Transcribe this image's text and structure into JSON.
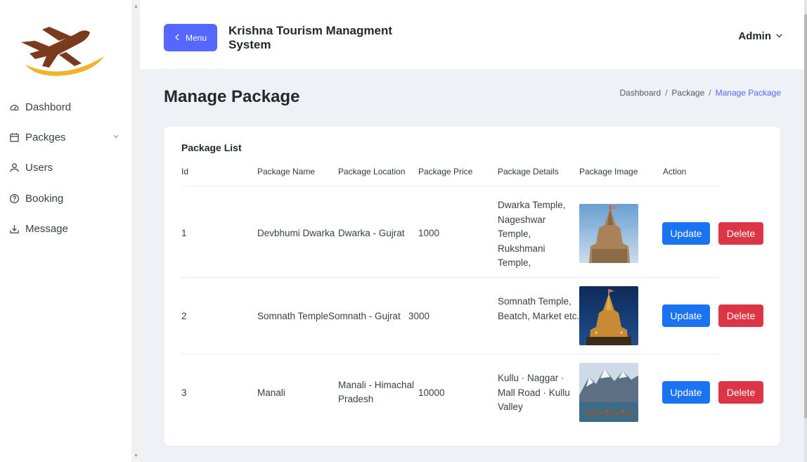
{
  "sidebar": {
    "items": [
      {
        "label": "Dashbord",
        "icon": "dashboard-icon"
      },
      {
        "label": "Packges",
        "icon": "calendar-icon"
      },
      {
        "label": "Users",
        "icon": "user-icon"
      },
      {
        "label": "Booking",
        "icon": "help-circle-icon"
      },
      {
        "label": "Message",
        "icon": "download-icon"
      }
    ]
  },
  "topbar": {
    "menu_label": "Menu",
    "app_title": "Krishna Tourism Managment System",
    "user": "Admin"
  },
  "page": {
    "title": "Manage Package",
    "breadcrumb": [
      "Dashboard",
      "Package",
      "Manage Package"
    ]
  },
  "table": {
    "title": "Package List",
    "headers": [
      "Id",
      "Package Name",
      "Package Location",
      "Package Price",
      "Package Details",
      "Package Image",
      "Action"
    ],
    "rows": [
      {
        "id": "1",
        "name": "Devbhumi Dwarka",
        "location": "Dwarka - Gujrat",
        "price": "1000",
        "details": "Dwarka Temple, Nageshwar Temple, Rukshmani Temple,",
        "image": "dwarka-temple-photo",
        "update": "Update",
        "delete": "Delete"
      },
      {
        "id": "2",
        "name": "Somnath Temple",
        "location": "Somnath - Gujrat",
        "price": "3000",
        "details": "Somnath Temple, Beatch, Market etc.",
        "image": "somnath-temple-photo",
        "update": "Update",
        "delete": "Delete"
      },
      {
        "id": "3",
        "name": "Manali",
        "location": "Manali - Himachal Pradesh",
        "price": "10000",
        "details": "Kullu · Naggar · Mall Road · Kullu Valley",
        "image": "manali-lake-photo",
        "update": "Update",
        "delete": "Delete"
      }
    ]
  },
  "colors": {
    "accent": "#5468ff",
    "update_button": "#1a73f0",
    "delete_button": "#dc3545",
    "background": "#eef1f6"
  }
}
